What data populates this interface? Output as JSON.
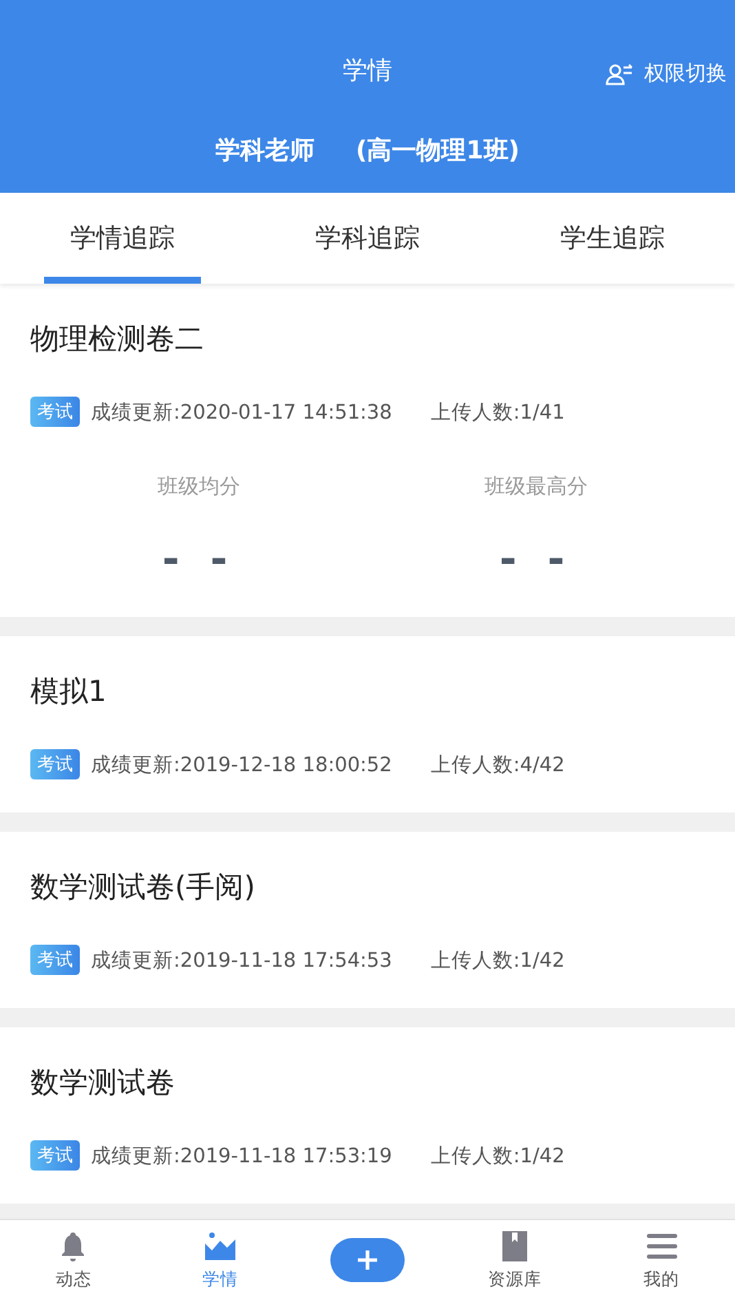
{
  "header": {
    "title": "学情",
    "switch_label": "权限切换"
  },
  "subheader": {
    "role": "学科老师",
    "class_name": "(高一物理1班)"
  },
  "tabs": [
    {
      "label": "学情追踪",
      "selected": true
    },
    {
      "label": "学科追踪",
      "selected": false
    },
    {
      "label": "学生追踪",
      "selected": false
    }
  ],
  "exams": [
    {
      "title": "物理检测卷二",
      "tag": "考试",
      "updated": "成绩更新:2020-01-17 14:51:38",
      "uploads": "上传人数:1/41",
      "stats": [
        {
          "label": "班级均分",
          "value": "- -"
        },
        {
          "label": "班级最高分",
          "value": "- -"
        }
      ]
    },
    {
      "title": "模拟1",
      "tag": "考试",
      "updated": "成绩更新:2019-12-18 18:00:52",
      "uploads": "上传人数:4/42"
    },
    {
      "title": "数学测试卷(手阅)",
      "tag": "考试",
      "updated": "成绩更新:2019-11-18 17:54:53",
      "uploads": "上传人数:1/42"
    },
    {
      "title": "数学测试卷",
      "tag": "考试",
      "updated": "成绩更新:2019-11-18 17:53:19",
      "uploads": "上传人数:1/42"
    }
  ],
  "bottom_nav": [
    {
      "kind": "tab",
      "label": "动态",
      "selected": false
    },
    {
      "kind": "tab",
      "label": "学情",
      "selected": true
    },
    {
      "kind": "add"
    },
    {
      "kind": "tab",
      "label": "资源库",
      "selected": false
    },
    {
      "kind": "tab",
      "label": "我的",
      "selected": false
    }
  ]
}
